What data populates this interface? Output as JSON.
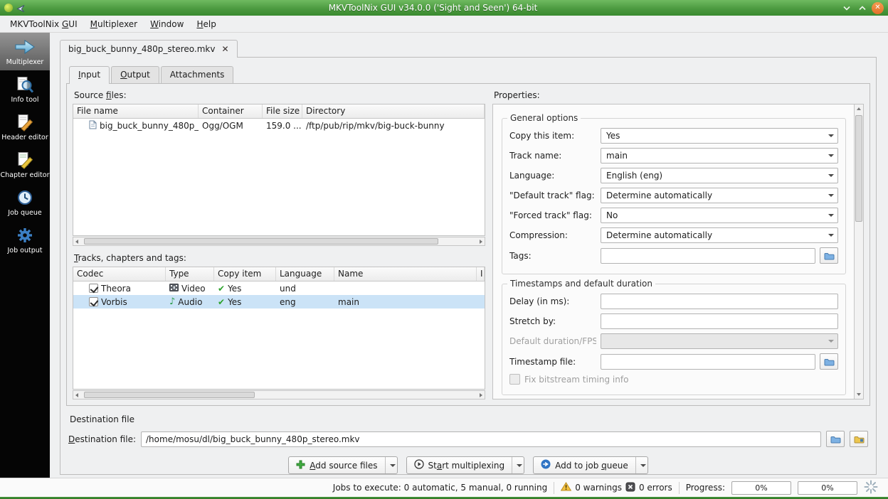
{
  "window": {
    "title": "MKVToolNix GUI v34.0.0 ('Sight and Seen') 64-bit"
  },
  "menubar": {
    "items": [
      {
        "label": "MKVToolNix &GUI"
      },
      {
        "label": "&Multiplexer"
      },
      {
        "label": "&Window"
      },
      {
        "label": "&Help"
      }
    ]
  },
  "sidebar": {
    "items": [
      {
        "label": "Multiplexer",
        "active": true
      },
      {
        "label": "Info tool",
        "active": false
      },
      {
        "label": "Header editor",
        "active": false
      },
      {
        "label": "Chapter editor",
        "active": false
      },
      {
        "label": "Job queue",
        "active": false
      },
      {
        "label": "Job output",
        "active": false
      }
    ]
  },
  "document_tab": {
    "label": "big_buck_bunny_480p_stereo.mkv"
  },
  "tabs": {
    "input": "&Input",
    "output": "&Output",
    "attachments": "Attachments"
  },
  "source_files": {
    "label": "Source &files:",
    "columns": [
      "File name",
      "Container",
      "File size",
      "Directory"
    ],
    "rows": [
      {
        "file_name": "big_buck_bunny_480p_...",
        "container": "Ogg/OGM",
        "file_size": "159.0 ...",
        "directory": "/ftp/pub/rip/mkv/big-buck-bunny"
      }
    ]
  },
  "tracks": {
    "label": "&Tracks, chapters and tags:",
    "columns": [
      "Codec",
      "Type",
      "Copy item",
      "Language",
      "Name",
      "I"
    ],
    "rows": [
      {
        "checked": true,
        "codec": "Theora",
        "type": "Video",
        "copy_item": "Yes",
        "language": "und",
        "name": ""
      },
      {
        "checked": true,
        "codec": "Vorbis",
        "type": "Audio",
        "copy_item": "Yes",
        "language": "eng",
        "name": "main"
      }
    ]
  },
  "properties": {
    "label": "Properties:",
    "general": {
      "title": "General options",
      "fields": [
        {
          "label": "Copy this item:",
          "value": "Yes"
        },
        {
          "label": "Track name:",
          "value": "main"
        },
        {
          "label": "Language:",
          "value": "English (eng)"
        },
        {
          "label": "\"Default track\" flag:",
          "value": "Determine automatically"
        },
        {
          "label": "\"Forced track\" flag:",
          "value": "No"
        },
        {
          "label": "Compression:",
          "value": "Determine automatically"
        },
        {
          "label": "Tags:",
          "value": ""
        }
      ]
    },
    "timestamps": {
      "title": "Timestamps and default duration",
      "fields": [
        {
          "label": "Delay (in ms):",
          "value": ""
        },
        {
          "label": "Stretch by:",
          "value": ""
        },
        {
          "label": "Default duration/FPS:",
          "value": ""
        },
        {
          "label": "Timestamp file:",
          "value": ""
        }
      ],
      "checkbox_label": "Fix bitstream timing info"
    }
  },
  "destination": {
    "section_label": "Destination file",
    "field_label": "&Destination file:",
    "value": "/home/mosu/dl/big_buck_bunny_480p_stereo.mkv"
  },
  "actions": {
    "add_source_files": "&Add source files",
    "start_multiplexing": "St&art multiplexing",
    "add_to_job_queue": "Add to job &queue"
  },
  "statusbar": {
    "jobs": "Jobs to execute: 0 automatic, 5 manual, 0 running",
    "warnings": "0 warnings",
    "errors": "0 errors",
    "progress_label": "Progress:",
    "progress_left": "0%",
    "progress_right": "0%"
  },
  "icons": {
    "copy_check": "✔",
    "audio_note": "♪",
    "close_x": "✕"
  }
}
